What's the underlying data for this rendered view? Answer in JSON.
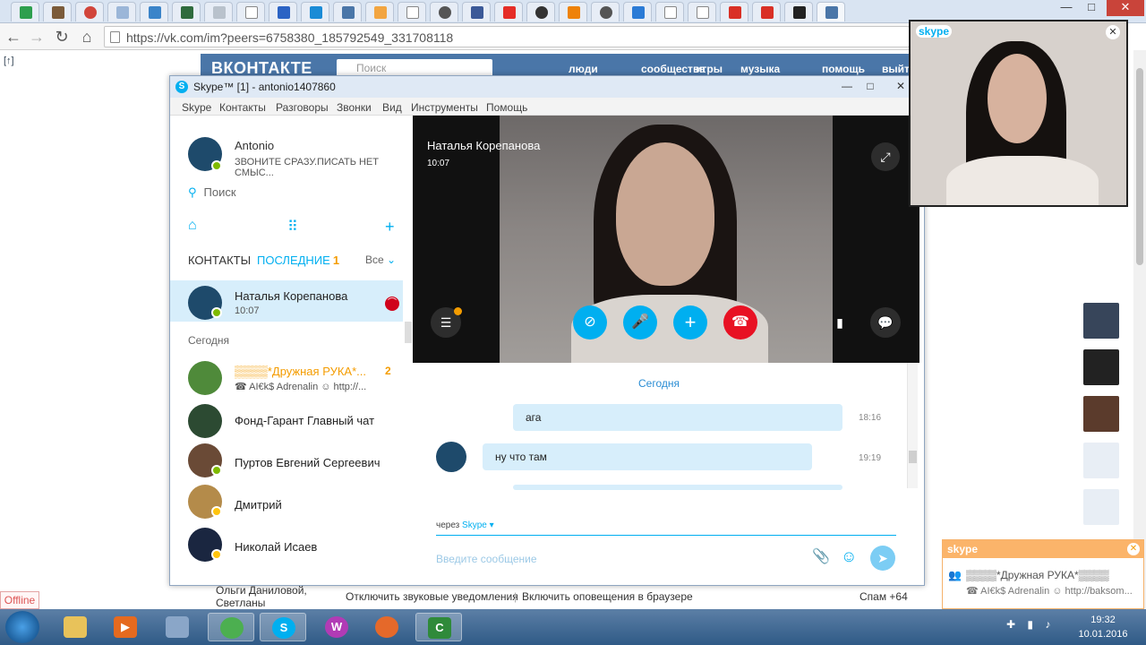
{
  "browser": {
    "url": "https://vk.com/im?peers=6758380_185792549_331708118",
    "window_controls": {
      "minimize": "—",
      "maximize": "□",
      "close": "✕"
    }
  },
  "vk": {
    "logo": "ВКОНТАКТЕ",
    "search_placeholder": "Поиск",
    "nav": [
      "люди",
      "сообщества",
      "игры",
      "музыка",
      "помощь",
      "выйт"
    ],
    "left_marker": "[↑]",
    "offline": "Offline",
    "footer_user": "Ольги Даниловой, Светланы",
    "footer_sound": "Отключить звуковые уведомления",
    "footer_sep": "|",
    "footer_browser": "Включить оповещения в браузере",
    "footer_spam": "Спам +64"
  },
  "skype": {
    "title": "Skype™ [1] - antonio1407860",
    "window_controls": {
      "minimize": "—",
      "maximize": "□",
      "close": "✕"
    },
    "menu": [
      "Skype",
      "Контакты",
      "Разговоры",
      "Звонки",
      "Вид",
      "Инструменты",
      "Помощь"
    ],
    "profile": {
      "name": "Antonio",
      "mood": "ЗВОНИТЕ СРАЗУ.ПИСАТЬ НЕТ СМЫС..."
    },
    "search_placeholder": "Поиск",
    "tabs": {
      "contacts": "КОНТАКТЫ",
      "recent": "ПОСЛЕДНИЕ",
      "recent_count": "1",
      "filter": "Все"
    },
    "active_contact": {
      "name": "Наталья Корепанова",
      "time": "10:07"
    },
    "today_label": "Сегодня",
    "contacts": [
      {
        "name": "▒▒▒▒*Дружная РУКА*...",
        "sub": "☎ AI€k$ Adrenalin ☺ http://...",
        "unread": "2"
      },
      {
        "name": "Фонд-Гарант Главный чат"
      },
      {
        "name": "Пуртов Евгений Сергеевич"
      },
      {
        "name": "Дмитрий"
      },
      {
        "name": "Николай Исаев"
      }
    ],
    "call": {
      "name": "Наталья Корепанова",
      "time": "10:07",
      "expand_icon": "⤢",
      "list_icon": "☰",
      "video_off_icon": "⊘",
      "mic_icon": "🎤",
      "add_icon": "+",
      "hangup_icon": "☎",
      "signal_icon": "▮",
      "chat_icon": "💬"
    },
    "chat": {
      "day": "Сегодня",
      "messages": [
        {
          "text": "ага",
          "time": "18:16"
        },
        {
          "text": "ну что там",
          "time": "19:19"
        }
      ],
      "via": "через",
      "via_service": "Skype ▾",
      "compose_placeholder": "Введите сообщение",
      "attach_icon": "📎",
      "emoji_icon": "☺",
      "send_icon": "➤"
    },
    "self_view": {
      "tag": "skype",
      "close": "✕"
    },
    "notification": {
      "tag": "skype",
      "close": "✕",
      "line1": "▒▒▒▒*Дружная РУКА*▒▒▒▒",
      "line2": "☎ AI€k$ Adrenalin ☺ http://baksom..."
    }
  },
  "taskbar": {
    "time": "19:32",
    "date": "10.01.2016"
  },
  "colors": {
    "vk_blue": "#4a76a8",
    "skype_blue": "#00aff0",
    "hangup_red": "#e81123",
    "accent_orange": "#f49c00"
  }
}
